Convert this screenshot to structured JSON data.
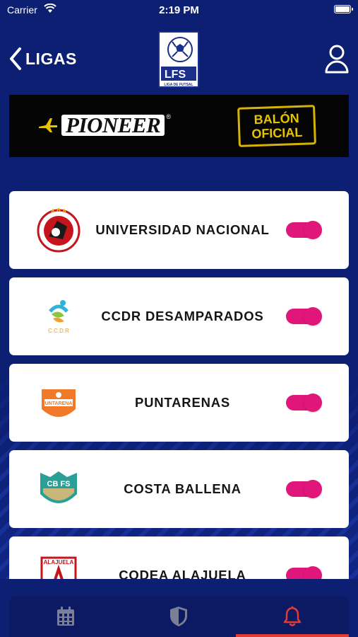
{
  "status_bar": {
    "carrier": "Carrier",
    "time": "2:19 PM"
  },
  "header": {
    "back_label": "LIGAS",
    "logo_text": "LFS",
    "logo_caption": "LIGA DE FUTSAL"
  },
  "sponsor": {
    "brand": "PIONEER",
    "reg_mark": "®",
    "balon_line1": "BALÓN",
    "balon_line2": "OFICIAL"
  },
  "teams": [
    {
      "name": "UNIVERSIDAD NACIONAL",
      "enabled": true
    },
    {
      "name": "CCDR DESAMPARADOS",
      "enabled": true,
      "crest_caption": "C.C.D.R"
    },
    {
      "name": "PUNTARENAS",
      "enabled": true,
      "crest_caption": "PUNTARENAS"
    },
    {
      "name": "COSTA BALLENA",
      "enabled": true,
      "crest_caption": "CB FS"
    },
    {
      "name": "CODEA ALAJUELA",
      "enabled": true,
      "crest_caption": "ALAJUELA"
    }
  ],
  "tabs": [
    {
      "icon": "calendar-icon",
      "active": false
    },
    {
      "icon": "shield-icon",
      "active": false
    },
    {
      "icon": "bell-icon",
      "active": true
    }
  ],
  "colors": {
    "background": "#0d1f73",
    "toggle": "#e0167a",
    "active_tab": "#e23b33"
  }
}
